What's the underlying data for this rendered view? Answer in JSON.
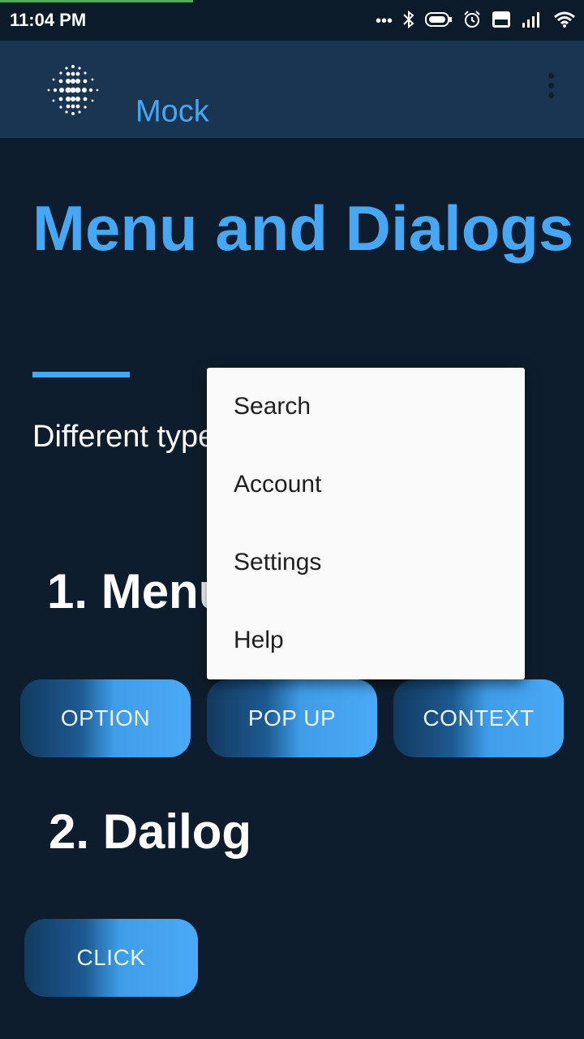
{
  "status_bar": {
    "time": "11:04 PM",
    "icons": [
      "more-dots-icon",
      "bluetooth-icon",
      "battery-icon",
      "alarm-icon",
      "volte-icon",
      "signal-icon",
      "wifi-icon"
    ]
  },
  "app_bar": {
    "title": "Mock",
    "logo_icon": "dots-logo-icon",
    "overflow_icon": "more-vert-icon"
  },
  "main": {
    "heading": "Menu and Dialogs",
    "description": "Different types of menu and dialog.",
    "section_menu": "1. Menu",
    "section_dialog": "2. Dailog"
  },
  "buttons": {
    "option": "OPTION",
    "popup": "POP UP",
    "context": "CONTEXT",
    "click": "CLICK"
  },
  "popup_menu": {
    "items": [
      "Search",
      "Account",
      "Settings",
      "Help"
    ]
  },
  "colors": {
    "background": "#0e1d2d",
    "app_bar": "#1a3552",
    "accent": "#46a7f5",
    "menu_background": "#fafafa"
  }
}
